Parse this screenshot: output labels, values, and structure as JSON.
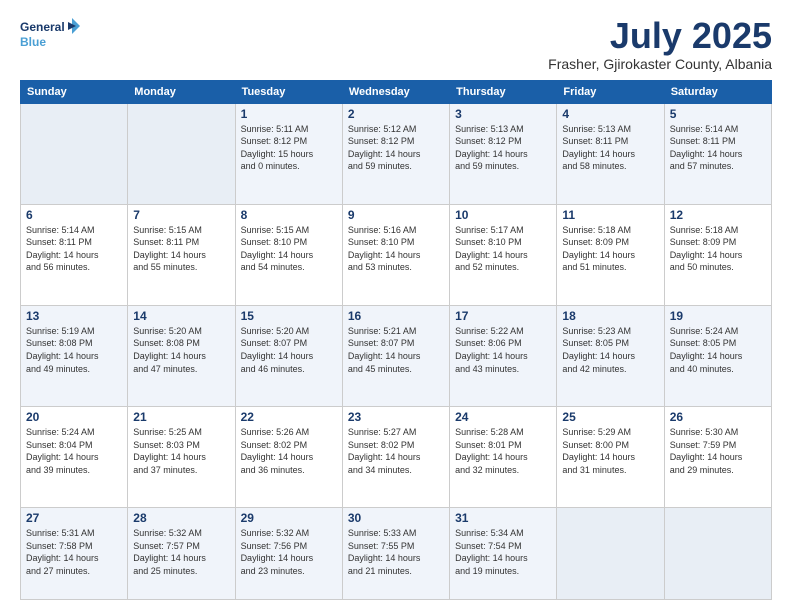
{
  "header": {
    "logo_line1": "General",
    "logo_line2": "Blue",
    "month": "July 2025",
    "location": "Frasher, Gjirokaster County, Albania"
  },
  "days_of_week": [
    "Sunday",
    "Monday",
    "Tuesday",
    "Wednesday",
    "Thursday",
    "Friday",
    "Saturday"
  ],
  "weeks": [
    [
      {
        "day": "",
        "info": ""
      },
      {
        "day": "",
        "info": ""
      },
      {
        "day": "1",
        "info": "Sunrise: 5:11 AM\nSunset: 8:12 PM\nDaylight: 15 hours\nand 0 minutes."
      },
      {
        "day": "2",
        "info": "Sunrise: 5:12 AM\nSunset: 8:12 PM\nDaylight: 14 hours\nand 59 minutes."
      },
      {
        "day": "3",
        "info": "Sunrise: 5:13 AM\nSunset: 8:12 PM\nDaylight: 14 hours\nand 59 minutes."
      },
      {
        "day": "4",
        "info": "Sunrise: 5:13 AM\nSunset: 8:11 PM\nDaylight: 14 hours\nand 58 minutes."
      },
      {
        "day": "5",
        "info": "Sunrise: 5:14 AM\nSunset: 8:11 PM\nDaylight: 14 hours\nand 57 minutes."
      }
    ],
    [
      {
        "day": "6",
        "info": "Sunrise: 5:14 AM\nSunset: 8:11 PM\nDaylight: 14 hours\nand 56 minutes."
      },
      {
        "day": "7",
        "info": "Sunrise: 5:15 AM\nSunset: 8:11 PM\nDaylight: 14 hours\nand 55 minutes."
      },
      {
        "day": "8",
        "info": "Sunrise: 5:15 AM\nSunset: 8:10 PM\nDaylight: 14 hours\nand 54 minutes."
      },
      {
        "day": "9",
        "info": "Sunrise: 5:16 AM\nSunset: 8:10 PM\nDaylight: 14 hours\nand 53 minutes."
      },
      {
        "day": "10",
        "info": "Sunrise: 5:17 AM\nSunset: 8:10 PM\nDaylight: 14 hours\nand 52 minutes."
      },
      {
        "day": "11",
        "info": "Sunrise: 5:18 AM\nSunset: 8:09 PM\nDaylight: 14 hours\nand 51 minutes."
      },
      {
        "day": "12",
        "info": "Sunrise: 5:18 AM\nSunset: 8:09 PM\nDaylight: 14 hours\nand 50 minutes."
      }
    ],
    [
      {
        "day": "13",
        "info": "Sunrise: 5:19 AM\nSunset: 8:08 PM\nDaylight: 14 hours\nand 49 minutes."
      },
      {
        "day": "14",
        "info": "Sunrise: 5:20 AM\nSunset: 8:08 PM\nDaylight: 14 hours\nand 47 minutes."
      },
      {
        "day": "15",
        "info": "Sunrise: 5:20 AM\nSunset: 8:07 PM\nDaylight: 14 hours\nand 46 minutes."
      },
      {
        "day": "16",
        "info": "Sunrise: 5:21 AM\nSunset: 8:07 PM\nDaylight: 14 hours\nand 45 minutes."
      },
      {
        "day": "17",
        "info": "Sunrise: 5:22 AM\nSunset: 8:06 PM\nDaylight: 14 hours\nand 43 minutes."
      },
      {
        "day": "18",
        "info": "Sunrise: 5:23 AM\nSunset: 8:05 PM\nDaylight: 14 hours\nand 42 minutes."
      },
      {
        "day": "19",
        "info": "Sunrise: 5:24 AM\nSunset: 8:05 PM\nDaylight: 14 hours\nand 40 minutes."
      }
    ],
    [
      {
        "day": "20",
        "info": "Sunrise: 5:24 AM\nSunset: 8:04 PM\nDaylight: 14 hours\nand 39 minutes."
      },
      {
        "day": "21",
        "info": "Sunrise: 5:25 AM\nSunset: 8:03 PM\nDaylight: 14 hours\nand 37 minutes."
      },
      {
        "day": "22",
        "info": "Sunrise: 5:26 AM\nSunset: 8:02 PM\nDaylight: 14 hours\nand 36 minutes."
      },
      {
        "day": "23",
        "info": "Sunrise: 5:27 AM\nSunset: 8:02 PM\nDaylight: 14 hours\nand 34 minutes."
      },
      {
        "day": "24",
        "info": "Sunrise: 5:28 AM\nSunset: 8:01 PM\nDaylight: 14 hours\nand 32 minutes."
      },
      {
        "day": "25",
        "info": "Sunrise: 5:29 AM\nSunset: 8:00 PM\nDaylight: 14 hours\nand 31 minutes."
      },
      {
        "day": "26",
        "info": "Sunrise: 5:30 AM\nSunset: 7:59 PM\nDaylight: 14 hours\nand 29 minutes."
      }
    ],
    [
      {
        "day": "27",
        "info": "Sunrise: 5:31 AM\nSunset: 7:58 PM\nDaylight: 14 hours\nand 27 minutes."
      },
      {
        "day": "28",
        "info": "Sunrise: 5:32 AM\nSunset: 7:57 PM\nDaylight: 14 hours\nand 25 minutes."
      },
      {
        "day": "29",
        "info": "Sunrise: 5:32 AM\nSunset: 7:56 PM\nDaylight: 14 hours\nand 23 minutes."
      },
      {
        "day": "30",
        "info": "Sunrise: 5:33 AM\nSunset: 7:55 PM\nDaylight: 14 hours\nand 21 minutes."
      },
      {
        "day": "31",
        "info": "Sunrise: 5:34 AM\nSunset: 7:54 PM\nDaylight: 14 hours\nand 19 minutes."
      },
      {
        "day": "",
        "info": ""
      },
      {
        "day": "",
        "info": ""
      }
    ]
  ]
}
